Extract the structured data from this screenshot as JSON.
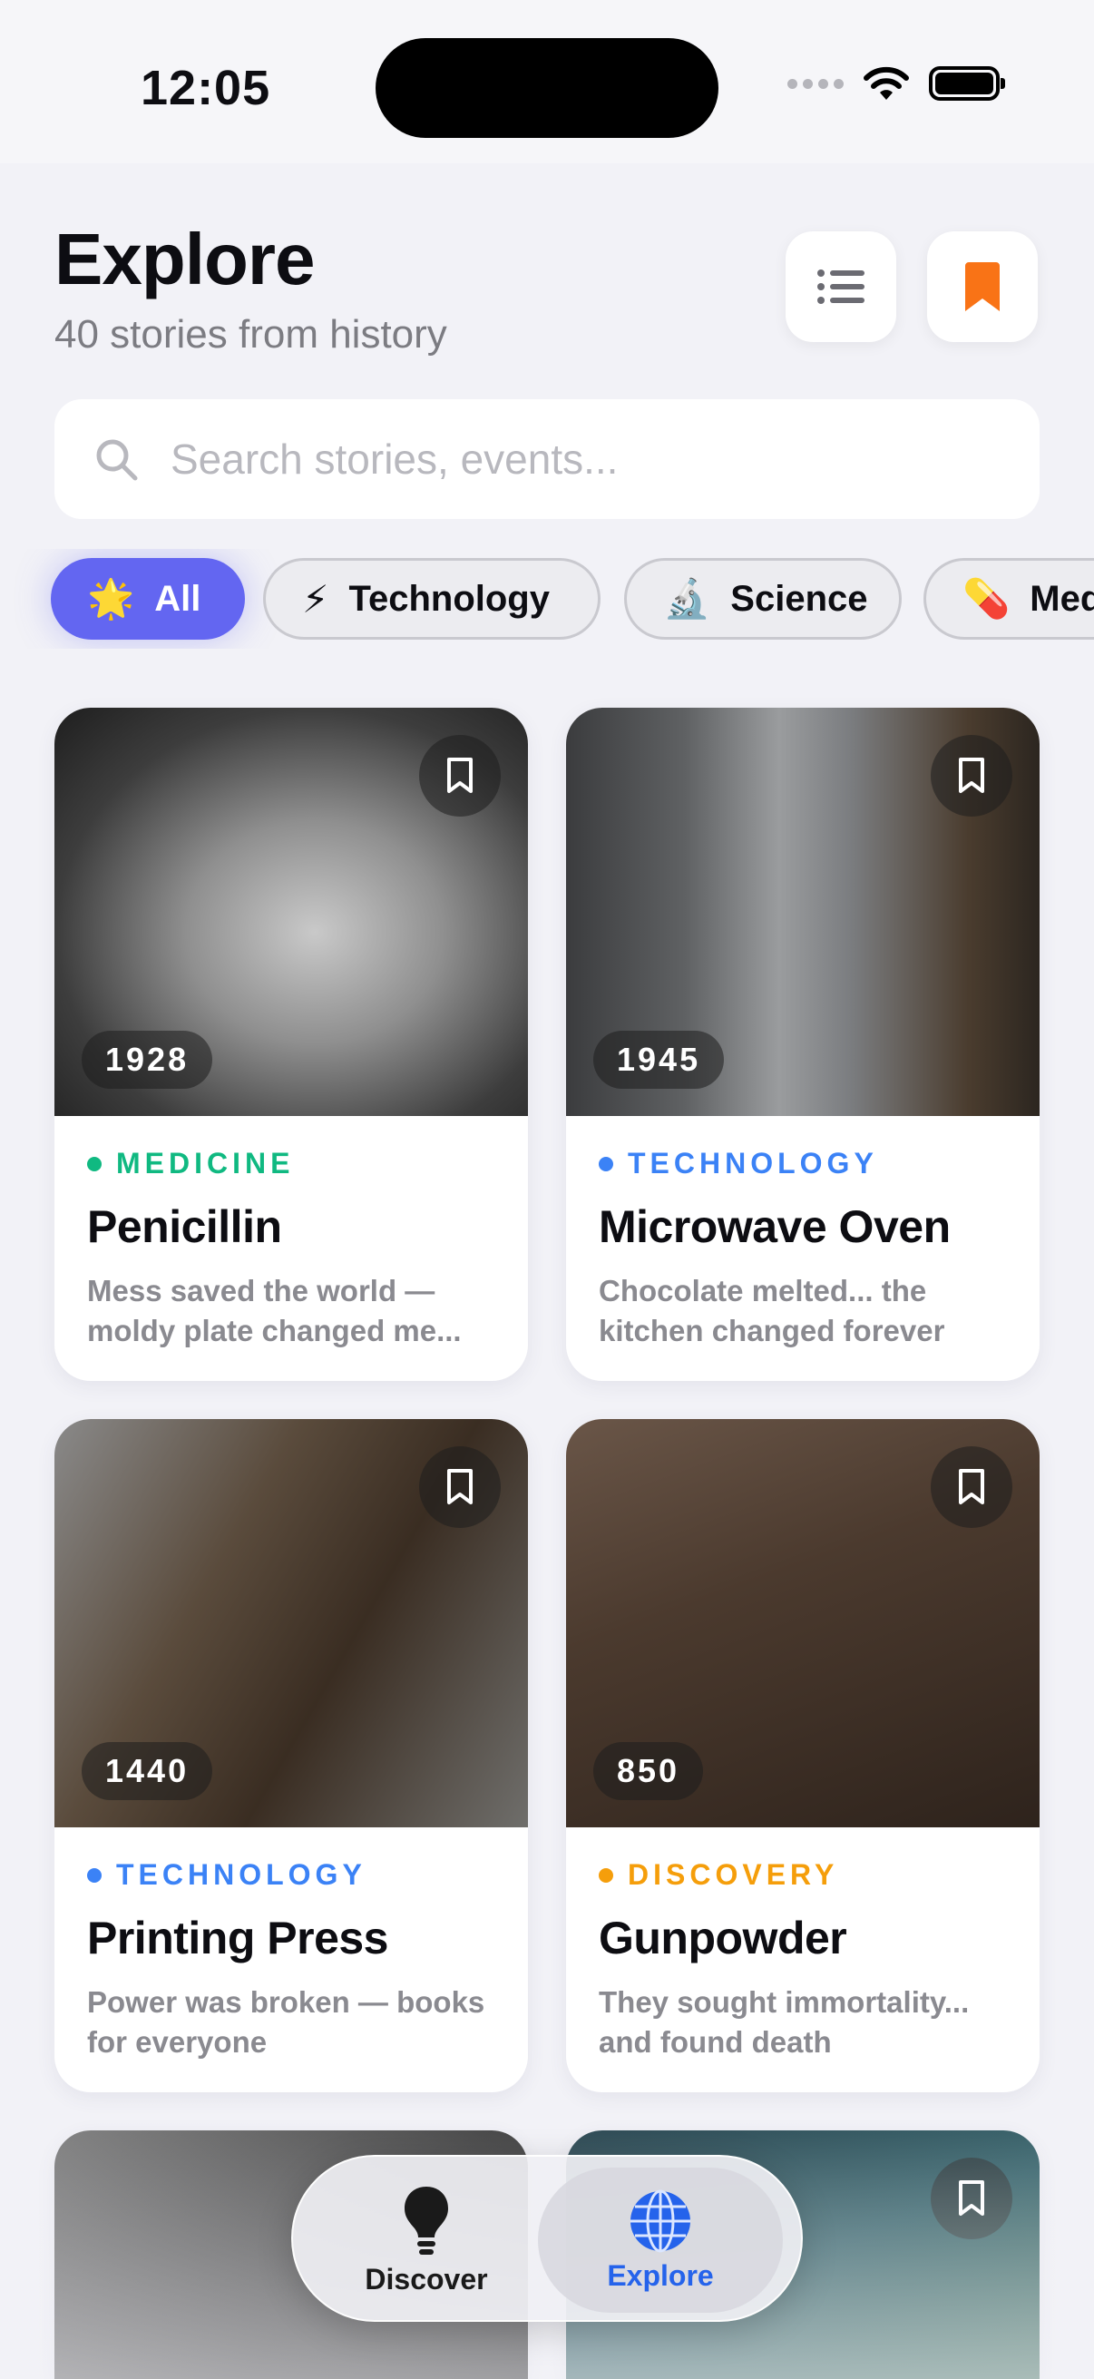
{
  "status_bar": {
    "time": "12:05"
  },
  "header": {
    "title": "Explore",
    "subtitle": "40 stories from history"
  },
  "search": {
    "placeholder": "Search stories, events..."
  },
  "chips": [
    {
      "icon": "🌟",
      "label": "All",
      "active": true
    },
    {
      "icon": "⚡",
      "label": "Technology",
      "active": false
    },
    {
      "icon": "🔬",
      "label": "Science",
      "active": false
    },
    {
      "icon": "💊",
      "label": "Med",
      "active": false
    }
  ],
  "cards": [
    {
      "year": "1928",
      "category": "MEDICINE",
      "category_color": "#10b981",
      "title": "Penicillin",
      "description": "Mess saved the world — moldy plate changed me..."
    },
    {
      "year": "1945",
      "category": "TECHNOLOGY",
      "category_color": "#3b82f6",
      "title": "Microwave Oven",
      "description": "Chocolate melted... the kitchen changed forever"
    },
    {
      "year": "1440",
      "category": "TECHNOLOGY",
      "category_color": "#3b82f6",
      "title": "Printing Press",
      "description": "Power was broken — books for everyone"
    },
    {
      "year": "850",
      "category": "DISCOVERY",
      "category_color": "#f59e0b",
      "title": "Gunpowder",
      "description": "They sought immortality... and found death"
    }
  ],
  "colors": {
    "accent": "#6366f1",
    "bookmark": "#f97316",
    "tab_active": "#2563eb"
  },
  "tabbar": {
    "discover_label": "Discover",
    "explore_label": "Explore",
    "discover_icon": "lightbulb-icon",
    "explore_icon": "globe-icon"
  }
}
